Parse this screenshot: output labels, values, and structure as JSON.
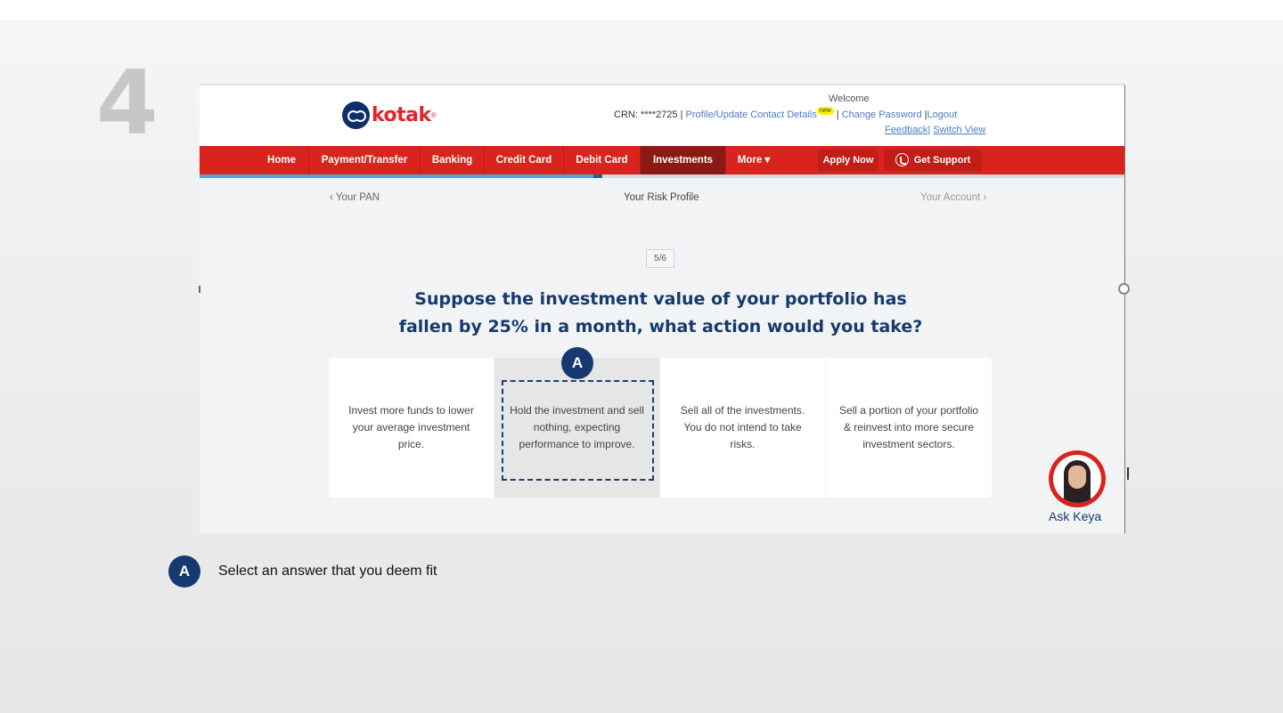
{
  "slide": {
    "step_number": "4",
    "callout_letter": "A",
    "legend_text": "Select an answer that you deem fit"
  },
  "app": {
    "brand": "kotak",
    "brand_mark": "®",
    "welcome": "Welcome",
    "crn": "CRN: ****2725 | ",
    "profile_link": "Profile/Update Contact Details",
    "new_badge": "new",
    "separator": " | ",
    "change_password": "Change Password",
    "logout_sep": " |",
    "logout": "Logout",
    "feedback": "Feedback",
    "pipe": "| ",
    "switch_view": "Switch View",
    "nav": [
      "Home",
      "Payment/Transfer",
      "Banking",
      "Credit Card",
      "Debit Card",
      "Investments",
      "More ▾"
    ],
    "apply_now": "Apply Now",
    "get_support": "Get Support",
    "progress_fraction": 0.425
  },
  "wizard": {
    "prev": "‹ Your PAN",
    "current": "Your Risk Profile",
    "next": "Your Account ›",
    "counter": "5/6",
    "question_line1": "Suppose the investment value of your portfolio has",
    "question_line2": "fallen by 25%  in a month, what action would you take?",
    "options": [
      "Invest more funds to lower your average investment price.",
      "Hold the investment and sell nothing, expecting performance to improve.",
      "Sell all of the investments. You do not intend to take risks.",
      "Sell a portion of your portfolio & reinvest into more secure investment sectors."
    ],
    "selected_index": 1,
    "assistant_label": "Ask Keya"
  },
  "colors": {
    "nav_red": "#d8241d",
    "nav_active": "#8b1a14",
    "question_blue": "#163a6d",
    "callout_blue": "#17396f"
  }
}
